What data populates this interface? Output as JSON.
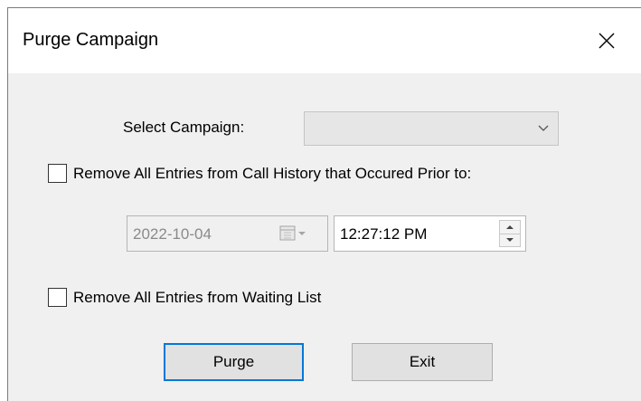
{
  "window": {
    "title": "Purge Campaign"
  },
  "campaign": {
    "label": "Select Campaign:",
    "selected": ""
  },
  "call_history": {
    "checkbox_label": "Remove All Entries from Call History that Occured Prior to:",
    "checked": false,
    "date_value": "2022-10-04",
    "time_value": "12:27:12 PM"
  },
  "waiting_list": {
    "checkbox_label": "Remove All Entries from Waiting List",
    "checked": false
  },
  "buttons": {
    "purge_label": "Purge",
    "exit_label": "Exit"
  },
  "icons": {
    "close": "close-icon",
    "dropdown": "chevron-down-icon",
    "calendar": "calendar-icon",
    "spin_up": "spin-up-icon",
    "spin_down": "spin-down-icon"
  },
  "colors": {
    "accent": "#0078d7",
    "dialog_bg": "#f0f0f0"
  }
}
